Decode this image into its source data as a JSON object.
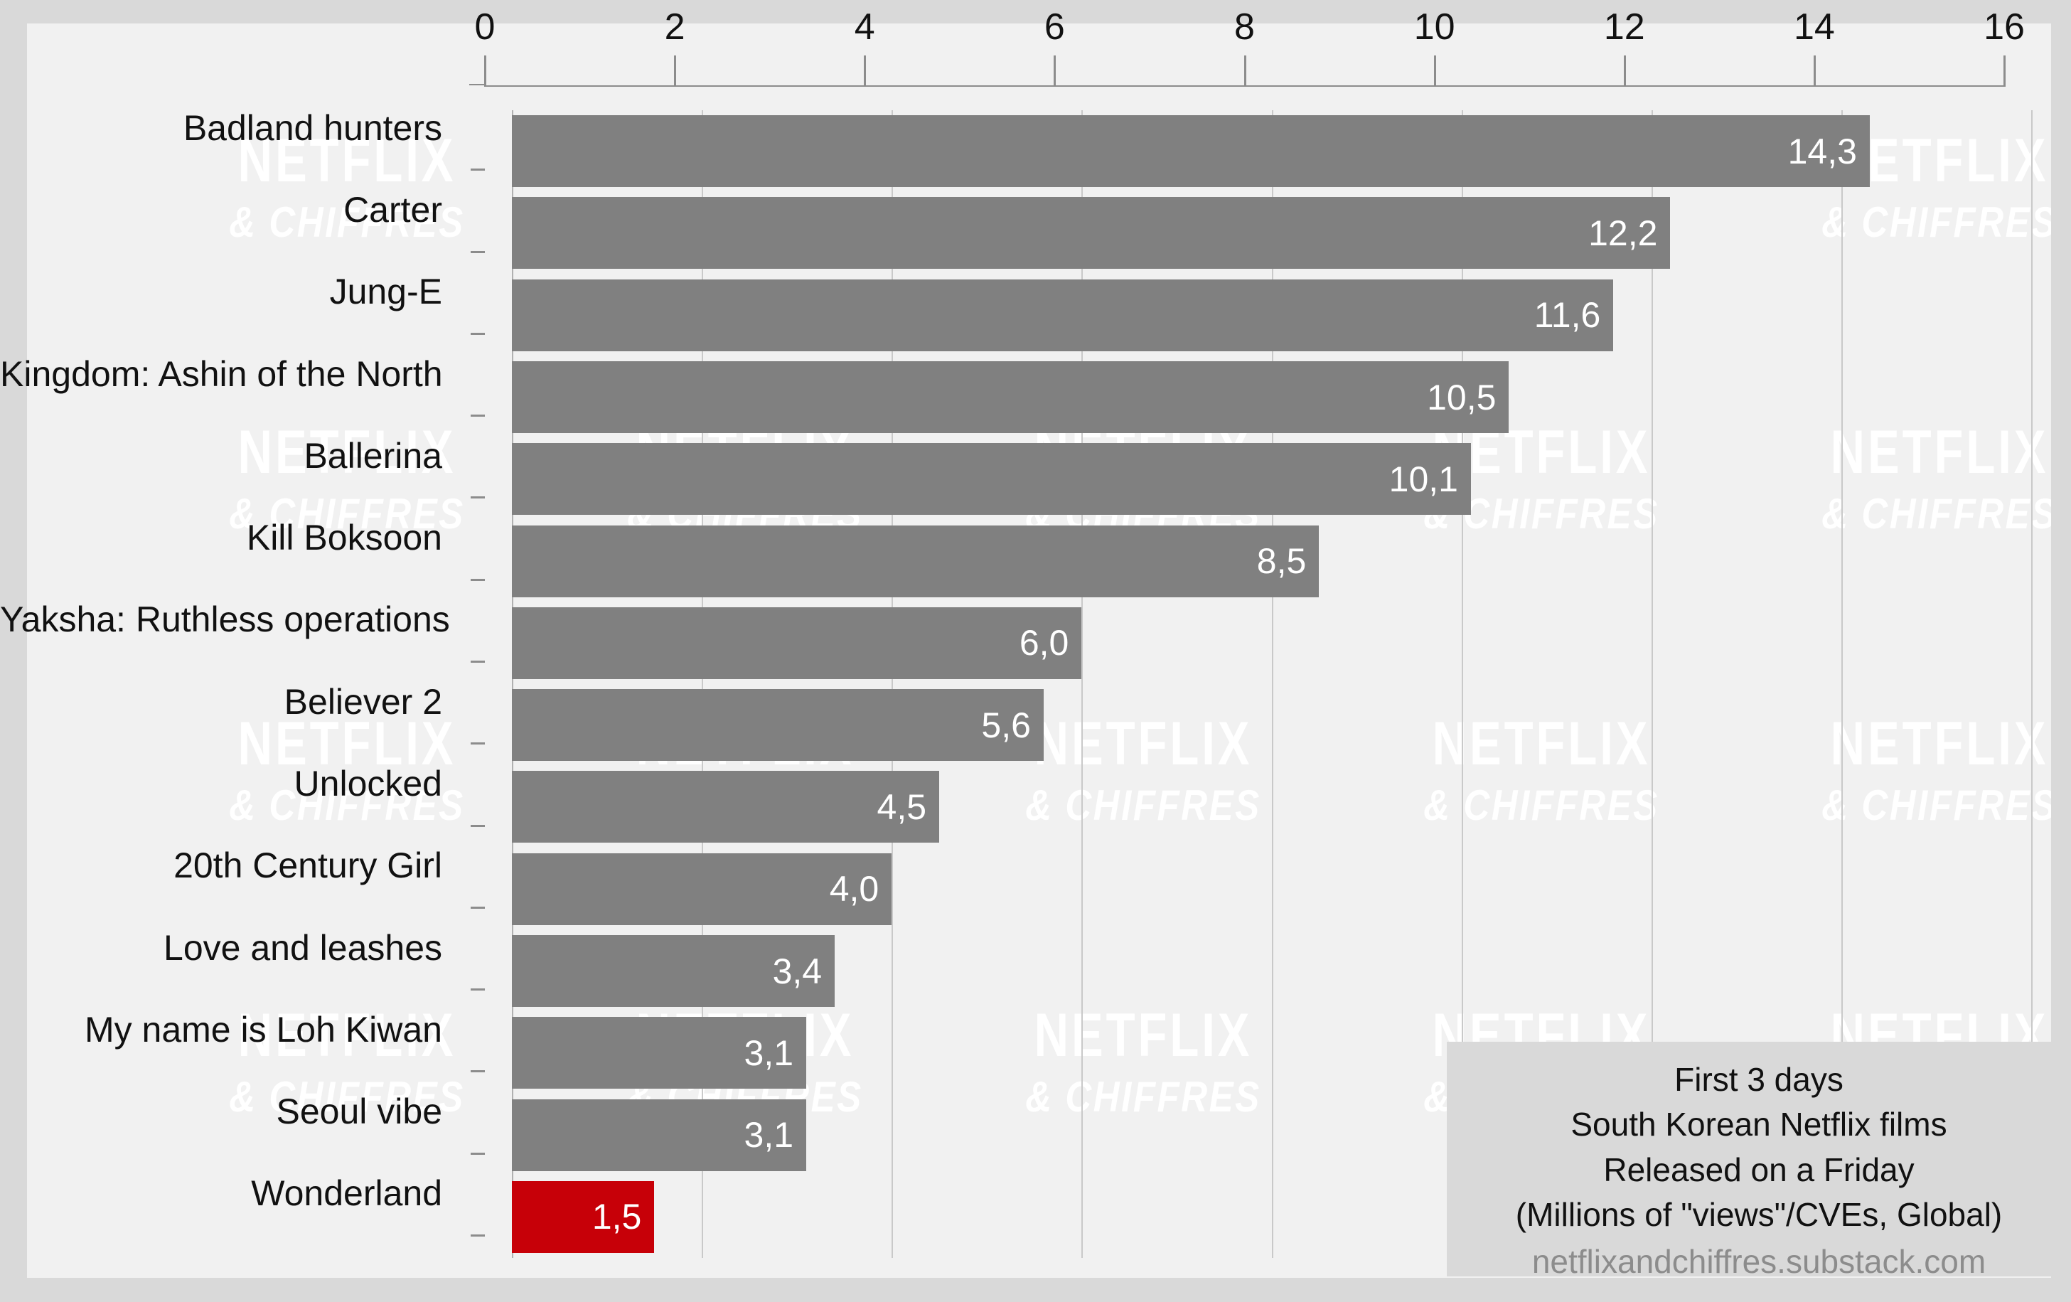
{
  "chart_data": {
    "type": "bar",
    "orientation": "horizontal",
    "title": "",
    "xlabel": "",
    "ylabel": "",
    "xlim": [
      0,
      16
    ],
    "xticks": [
      "0",
      "2",
      "4",
      "6",
      "8",
      "10",
      "12",
      "14",
      "16"
    ],
    "xtick_values": [
      0,
      2,
      4,
      6,
      8,
      10,
      12,
      14,
      16
    ],
    "grid": true,
    "grid_axis": "x",
    "legend": "none",
    "decimal_separator": ",",
    "categories": [
      "Badland hunters",
      "Carter",
      "Jung-E",
      "Kingdom: Ashin of the North",
      "Ballerina",
      "Kill Boksoon",
      "Yaksha: Ruthless operations",
      "Believer 2",
      "Unlocked",
      "20th Century Girl",
      "Love and leashes",
      "My name is Loh Kiwan",
      "Seoul vibe",
      "Wonderland"
    ],
    "values": [
      14.3,
      12.2,
      11.6,
      10.5,
      10.1,
      8.5,
      6.0,
      5.6,
      4.5,
      4.0,
      3.4,
      3.1,
      3.1,
      1.5
    ],
    "value_labels": [
      "14,3",
      "12,2",
      "11,6",
      "10,5",
      "10,1",
      "8,5",
      "6,0",
      "5,6",
      "4,5",
      "4,0",
      "3,4",
      "3,1",
      "3,1",
      "1,5"
    ],
    "highlight_index": 13,
    "colors": {
      "bar": "#808080",
      "highlight_bar": "#c70008",
      "plot_background": "#f1f1f1",
      "figure_background": "#d9d9d9",
      "gridline": "#c9c9c9",
      "axis": "#8c8c8c",
      "value_label": "#ffffff",
      "tick_label": "#111111"
    }
  },
  "caption": {
    "line1": "First 3 days",
    "line2": "South Korean Netflix films",
    "line3": "Released on a Friday",
    "line4": "(Millions of \"views\"/CVEs, Global)",
    "source": "netflixandchiffres.substack.com"
  },
  "watermark": {
    "top": "NETFLIX",
    "bottom": "& CHIFFRES"
  }
}
